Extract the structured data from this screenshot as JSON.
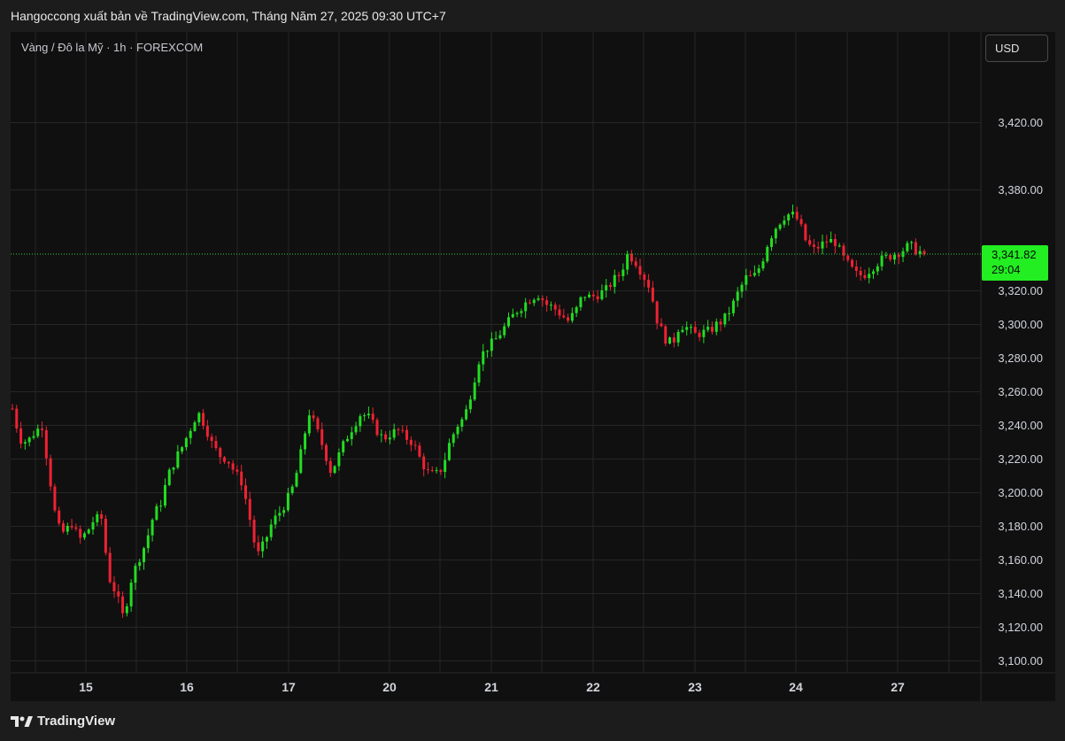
{
  "header": {
    "caption": "Hangoccong xuất bản về TradingView.com, Tháng Năm 27, 2025 09:30 UTC+7"
  },
  "symbol_line": "Vàng / Đô la Mỹ · 1h · FOREXCOM",
  "currency_button": "USD",
  "footer": {
    "brand": "TradingView",
    "logo_icon": "tradingview-logo-icon"
  },
  "colors": {
    "background": "#101010",
    "up": "#22dd22",
    "down": "#ee2233",
    "grid": "#262626",
    "last_price_line": "#2ecc40",
    "last_price_badge": "#22ee22"
  },
  "chart_data": {
    "type": "candlestick",
    "title": "",
    "y_axis_ticks": [
      3100,
      3120,
      3140,
      3160,
      3180,
      3200,
      3220,
      3240,
      3260,
      3280,
      3300,
      3320,
      3380,
      3420
    ],
    "y_axis_tick_labels": [
      "3,100.00",
      "3,120.00",
      "3,140.00",
      "3,160.00",
      "3,180.00",
      "3,200.00",
      "3,220.00",
      "3,240.00",
      "3,260.00",
      "3,280.00",
      "3,300.00",
      "3,320.00",
      "3,380.00",
      "3,420.00"
    ],
    "x_axis_labels": [
      "15",
      "16",
      "17",
      "20",
      "21",
      "22",
      "23",
      "24",
      "27"
    ],
    "last_price": 3341.82,
    "last_price_label": "3,341.82",
    "countdown_label": "29:04",
    "grid": true,
    "day_closes": [
      {
        "day": "14",
        "close": 3240
      },
      {
        "day": "15",
        "close": 3160
      },
      {
        "day": "16",
        "close": 3225
      },
      {
        "day": "17",
        "close": 3190
      },
      {
        "day": "20",
        "close": 3218
      },
      {
        "day": "21",
        "close": 3290
      },
      {
        "day": "22",
        "close": 3320
      },
      {
        "day": "23",
        "close": 3300
      },
      {
        "day": "24",
        "close": 3353
      },
      {
        "day": "27",
        "close": 3341.82
      }
    ],
    "path": [
      [
        0,
        3250
      ],
      [
        4,
        3232
      ],
      [
        8,
        3230
      ],
      [
        12,
        3236
      ],
      [
        16,
        3240
      ],
      [
        20,
        3210
      ],
      [
        24,
        3180
      ],
      [
        28,
        3176
      ],
      [
        32,
        3182
      ],
      [
        36,
        3172
      ],
      [
        40,
        3176
      ],
      [
        44,
        3184
      ],
      [
        48,
        3185
      ],
      [
        52,
        3150
      ],
      [
        56,
        3140
      ],
      [
        60,
        3125
      ],
      [
        64,
        3148
      ],
      [
        68,
        3160
      ],
      [
        72,
        3170
      ],
      [
        76,
        3186
      ],
      [
        80,
        3194
      ],
      [
        84,
        3210
      ],
      [
        88,
        3220
      ],
      [
        92,
        3228
      ],
      [
        96,
        3238
      ],
      [
        100,
        3248
      ],
      [
        104,
        3240
      ],
      [
        108,
        3228
      ],
      [
        112,
        3222
      ],
      [
        116,
        3220
      ],
      [
        120,
        3212
      ],
      [
        124,
        3206
      ],
      [
        128,
        3185
      ],
      [
        132,
        3162
      ],
      [
        136,
        3170
      ],
      [
        140,
        3182
      ],
      [
        144,
        3188
      ],
      [
        148,
        3195
      ],
      [
        152,
        3205
      ],
      [
        156,
        3225
      ],
      [
        160,
        3248
      ],
      [
        164,
        3238
      ],
      [
        168,
        3226
      ],
      [
        172,
        3212
      ],
      [
        176,
        3222
      ],
      [
        180,
        3232
      ],
      [
        184,
        3240
      ],
      [
        188,
        3247
      ],
      [
        192,
        3245
      ],
      [
        196,
        3238
      ],
      [
        200,
        3232
      ],
      [
        204,
        3235
      ],
      [
        208,
        3237
      ],
      [
        212,
        3233
      ],
      [
        216,
        3230
      ],
      [
        220,
        3220
      ],
      [
        224,
        3212
      ],
      [
        228,
        3210
      ],
      [
        232,
        3215
      ],
      [
        236,
        3230
      ],
      [
        240,
        3240
      ],
      [
        244,
        3245
      ],
      [
        248,
        3262
      ],
      [
        252,
        3280
      ],
      [
        256,
        3286
      ],
      [
        260,
        3290
      ],
      [
        264,
        3296
      ],
      [
        268,
        3302
      ],
      [
        272,
        3308
      ],
      [
        276,
        3312
      ],
      [
        280,
        3316
      ],
      [
        284,
        3318
      ],
      [
        288,
        3312
      ],
      [
        292,
        3310
      ],
      [
        296,
        3306
      ],
      [
        300,
        3302
      ],
      [
        304,
        3308
      ],
      [
        308,
        3318
      ],
      [
        312,
        3316
      ],
      [
        316,
        3318
      ],
      [
        320,
        3320
      ],
      [
        324,
        3326
      ],
      [
        328,
        3330
      ],
      [
        332,
        3342
      ],
      [
        336,
        3338
      ],
      [
        340,
        3330
      ],
      [
        344,
        3322
      ],
      [
        348,
        3302
      ],
      [
        352,
        3292
      ],
      [
        356,
        3288
      ],
      [
        360,
        3300
      ],
      [
        364,
        3298
      ],
      [
        368,
        3294
      ],
      [
        372,
        3295
      ],
      [
        376,
        3296
      ],
      [
        380,
        3300
      ],
      [
        384,
        3303
      ],
      [
        388,
        3310
      ],
      [
        392,
        3320
      ],
      [
        396,
        3328
      ],
      [
        400,
        3328
      ],
      [
        404,
        3336
      ],
      [
        408,
        3350
      ],
      [
        412,
        3358
      ],
      [
        416,
        3364
      ],
      [
        420,
        3366
      ],
      [
        424,
        3362
      ],
      [
        428,
        3350
      ],
      [
        432,
        3344
      ],
      [
        436,
        3347
      ],
      [
        440,
        3350
      ],
      [
        444,
        3349
      ],
      [
        448,
        3340
      ],
      [
        452,
        3334
      ],
      [
        456,
        3329
      ],
      [
        460,
        3330
      ],
      [
        464,
        3334
      ],
      [
        468,
        3338
      ],
      [
        472,
        3340
      ],
      [
        476,
        3342
      ],
      [
        480,
        3344
      ],
      [
        484,
        3347
      ],
      [
        488,
        3344
      ],
      [
        492,
        3342
      ]
    ]
  }
}
